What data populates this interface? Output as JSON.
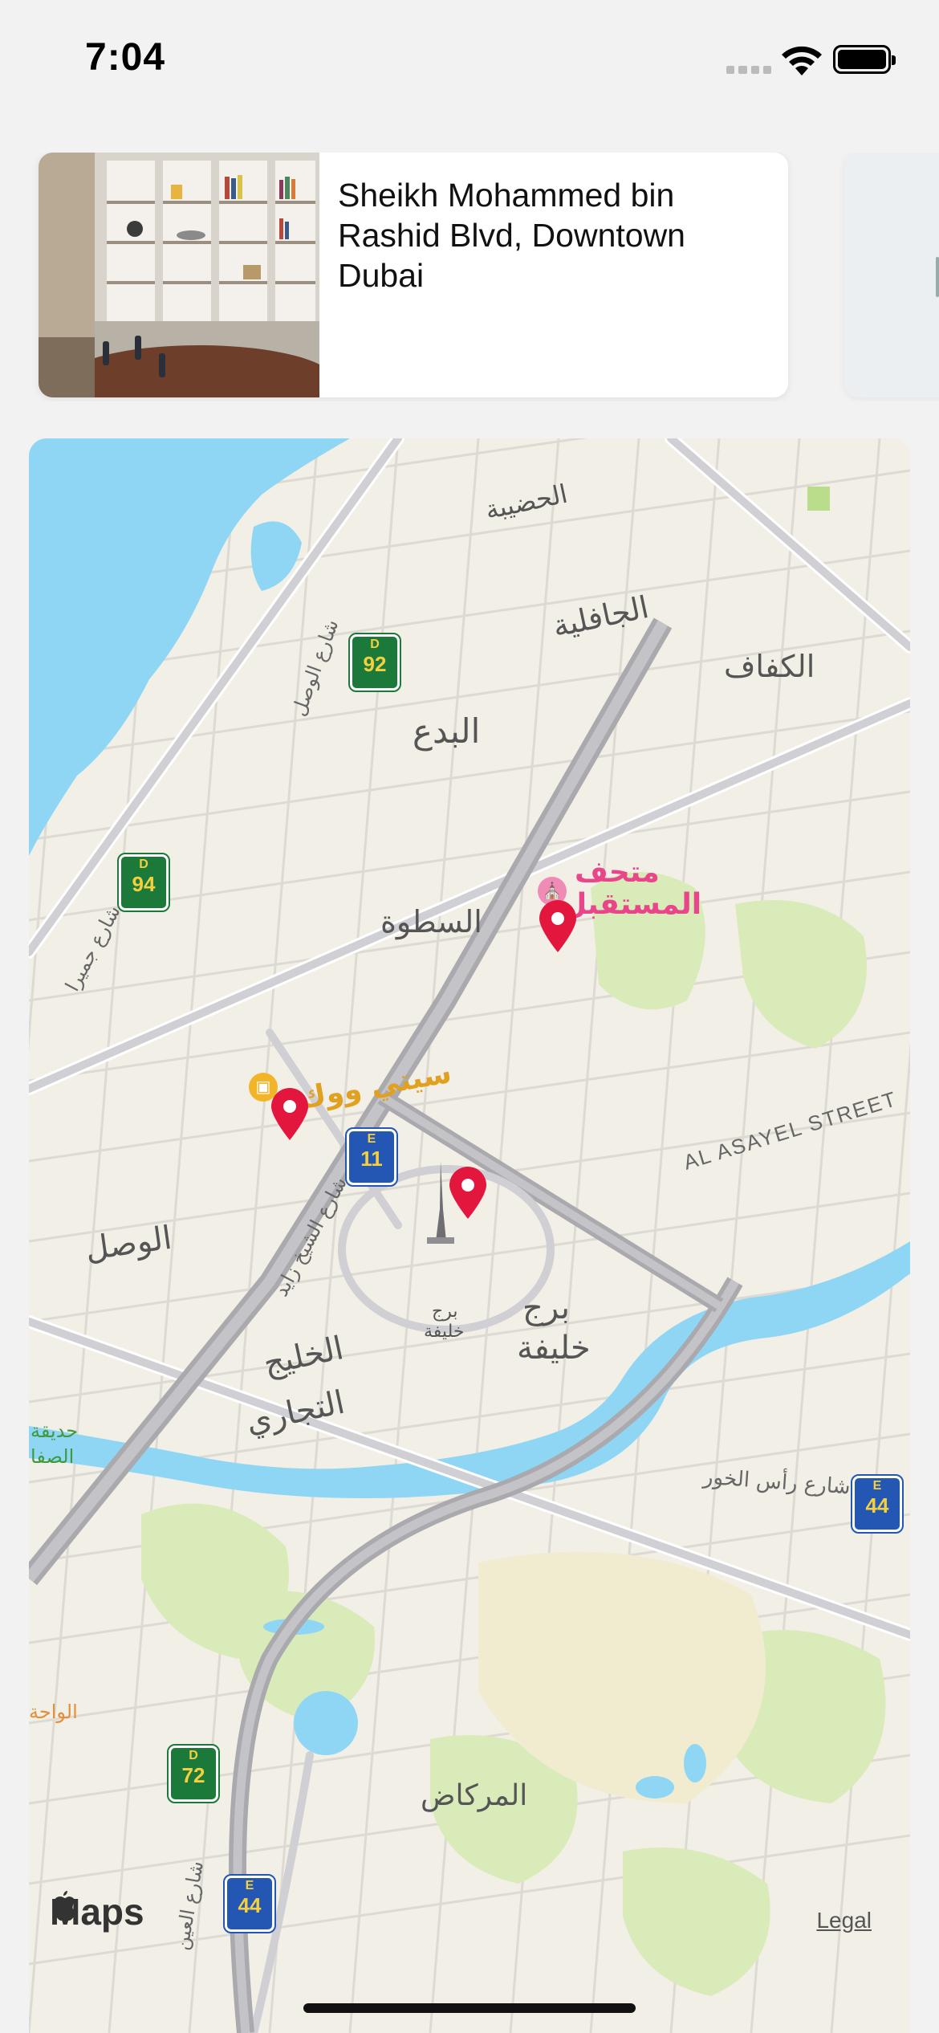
{
  "status_bar": {
    "time": "7:04"
  },
  "carousel": {
    "cards": [
      {
        "title": "Sheikh Mohammed bin Rashid Blvd, Downtown Dubai",
        "photo": "office-bookshelf-photo"
      }
    ]
  },
  "map": {
    "attribution": "Maps",
    "legal_label": "Legal",
    "labels": {
      "al_hudaiba": "الحضيبة",
      "al_jafiliya": "الجافلية",
      "al_kifaf": "الكفاف",
      "al_bada": "البدع",
      "al_satwa": "السطوة",
      "al_wasl": "الوصل",
      "business_bay_1": "الخليج",
      "business_bay_2": "التجاري",
      "burj_khalifa_1": "برج",
      "burj_khalifa_2": "خليفة",
      "burj_icon_label_1": "برج",
      "burj_icon_label_2": "خليفة",
      "museum_1": "متحف",
      "museum_2": "المستقبل",
      "city_walk": "سيتي ووك",
      "al_asayel": "AL ASAYEL STREET",
      "ras_al_khor": "شارع رأس الخور",
      "al_markad": "المركاض",
      "al_wasl_road": "شارع الوصل",
      "sheikh_zayed_road": "شارع الشيخ زايد",
      "jumeirah_st": "شارع جميرا",
      "al_safa_park_1": "حديقة",
      "al_safa_park_2": "الصفا",
      "al_wasl_edge": "الواحة",
      "road_street_bottom": "شارع العين"
    },
    "shields": [
      {
        "top": "D",
        "num": "92"
      },
      {
        "top": "D",
        "num": "94"
      },
      {
        "top": "E",
        "num": "11"
      },
      {
        "top": "E",
        "num": "44"
      },
      {
        "top": "D",
        "num": "72"
      },
      {
        "top": "E",
        "num": "44"
      }
    ],
    "pins": [
      "museum-of-the-future-pin",
      "city-walk-pin",
      "downtown-pin"
    ],
    "colors": {
      "water": "#8fd6f5",
      "land": "#f2efe6",
      "park": "#d9ebb9",
      "pin": "#e3173d",
      "road": "#c9c9ce",
      "highway": "#a9a9ae"
    }
  }
}
